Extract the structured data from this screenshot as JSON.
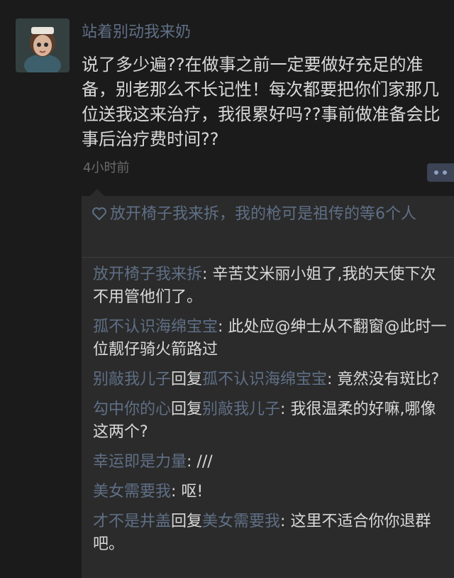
{
  "post": {
    "nickname": "站着别动我来奶",
    "text": "说了多少遍??在做事之前一定要做好充足的准备，别老那么不长记性！每次都要把你们家那几位送我这来治疗，我很累好吗??事前做准备会比事后治疗费时间??",
    "time": "4小时前"
  },
  "likes": {
    "icon": "heart-icon",
    "text": "放开椅子我来拆，我的枪可是祖传的等6个人"
  },
  "comments": [
    {
      "user": "放开椅子我来拆",
      "reply_word": "",
      "reply_to": "",
      "text": ": 辛苦艾米丽小姐了,我的天使下次不用管他们了。"
    },
    {
      "user": "孤不认识海绵宝宝",
      "reply_word": "",
      "reply_to": "",
      "text": ": 此处应@绅士从不翻窗@此时一位靓仔骑火箭路过"
    },
    {
      "user": "别敲我儿子",
      "reply_word": "回复",
      "reply_to": "孤不认识海绵宝宝",
      "text": ": 竟然没有斑比?"
    },
    {
      "user": "勾中你的心",
      "reply_word": "回复",
      "reply_to": "别敲我儿子",
      "text": ": 我很温柔的好嘛,哪像这两个?"
    },
    {
      "user": "幸运即是力量",
      "reply_word": "",
      "reply_to": "",
      "text": ": ///"
    },
    {
      "user": "美女需要我",
      "reply_word": "",
      "reply_to": "",
      "text": ": 呕!"
    },
    {
      "user": "才不是井盖",
      "reply_word": "回复",
      "reply_to": "美女需要我",
      "text": ": 这里不适合你你退群吧。"
    }
  ],
  "colors": {
    "background": "#1b1b1b",
    "username": "#5f6f86",
    "text": "#d9d9d9"
  }
}
